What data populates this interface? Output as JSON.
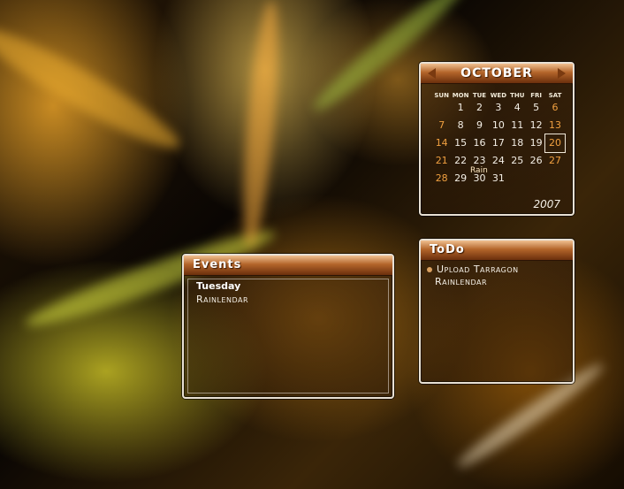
{
  "calendar": {
    "month": "October",
    "year": "2007",
    "days_of_week": [
      "SUN",
      "MON",
      "TUE",
      "WED",
      "THU",
      "FRI",
      "SAT"
    ],
    "weeks": [
      [
        "",
        "1",
        "2",
        "3",
        "4",
        "5",
        "6"
      ],
      [
        "7",
        "8",
        "9",
        "10",
        "11",
        "12",
        "13"
      ],
      [
        "14",
        "15",
        "16",
        "17",
        "18",
        "19",
        "20"
      ],
      [
        "21",
        "22",
        "23",
        "24",
        "25",
        "26",
        "27"
      ],
      [
        "28",
        "29",
        "30",
        "31",
        "",
        "",
        ""
      ]
    ],
    "today": "20",
    "event_label": "Rain"
  },
  "events": {
    "title": "Events",
    "day": "Tuesday",
    "item": "Rainlendar"
  },
  "todo": {
    "title": "ToDo",
    "item_line1": "Upload Tarragon",
    "item_line2": "Rainlendar"
  },
  "colors": {
    "accent": "#f0a040",
    "title_bar": "#b3652a",
    "text": "#f4efe6"
  }
}
